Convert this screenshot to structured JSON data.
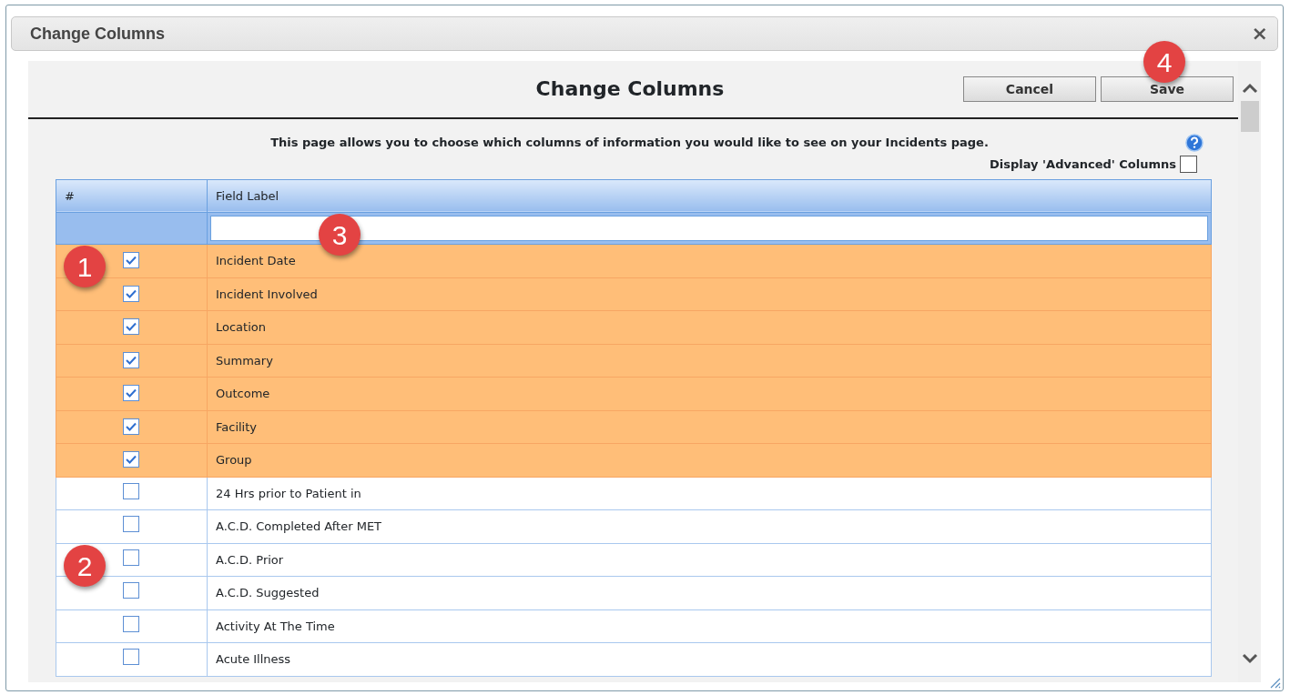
{
  "dialog": {
    "title": "Change Columns",
    "close": "×"
  },
  "page": {
    "title": "Change Columns",
    "buttons": [
      "Cancel",
      "Save"
    ],
    "description": "This page allows you to choose which columns of information you would like to see on your Incidents page.",
    "advanced": {
      "label": "Display 'Advanced' Columns",
      "checked": false
    }
  },
  "table": {
    "columns": [
      "#",
      "Field Label"
    ],
    "rows": [
      {
        "label": "Incident Date",
        "checked": true
      },
      {
        "label": "Incident Involved",
        "checked": true
      },
      {
        "label": "Location",
        "checked": true
      },
      {
        "label": "Summary",
        "checked": true
      },
      {
        "label": "Outcome",
        "checked": true
      },
      {
        "label": "Facility",
        "checked": true
      },
      {
        "label": "Group",
        "checked": true
      },
      {
        "label": "24 Hrs prior to Patient in",
        "checked": false
      },
      {
        "label": "A.C.D. Completed After MET",
        "checked": false
      },
      {
        "label": "A.C.D. Prior",
        "checked": false
      },
      {
        "label": "A.C.D. Suggested",
        "checked": false
      },
      {
        "label": "Activity At The Time",
        "checked": false
      },
      {
        "label": "Acute Illness",
        "checked": false
      }
    ]
  },
  "callouts": [
    "1",
    "2",
    "3",
    "4"
  ]
}
